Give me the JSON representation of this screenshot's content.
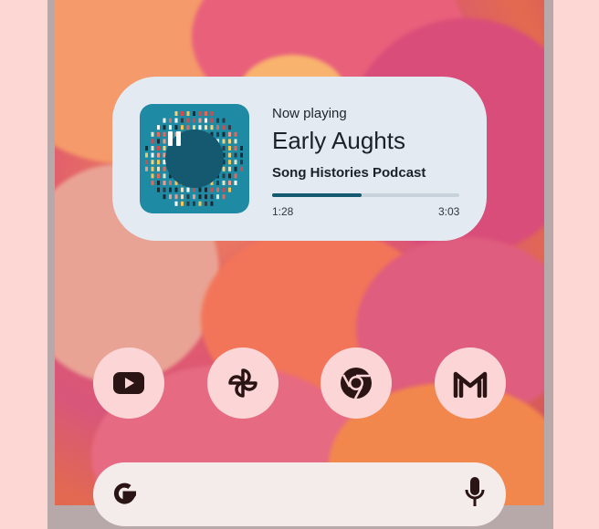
{
  "media": {
    "now_playing_label": "Now playing",
    "track_title": "Early Aughts",
    "podcast_name": "Song Histories Podcast",
    "elapsed": "1:28",
    "total": "3:03",
    "progress": 0.48,
    "play_state_icon": "pause-icon",
    "accent_color": "#14596f"
  },
  "apps": [
    {
      "name": "YouTube",
      "icon": "youtube-icon"
    },
    {
      "name": "Photos",
      "icon": "pinwheel-icon"
    },
    {
      "name": "Chrome",
      "icon": "chrome-icon"
    },
    {
      "name": "Gmail",
      "icon": "gmail-icon"
    }
  ],
  "search": {
    "logo_icon": "google-g-icon",
    "voice_icon": "microphone-icon"
  }
}
